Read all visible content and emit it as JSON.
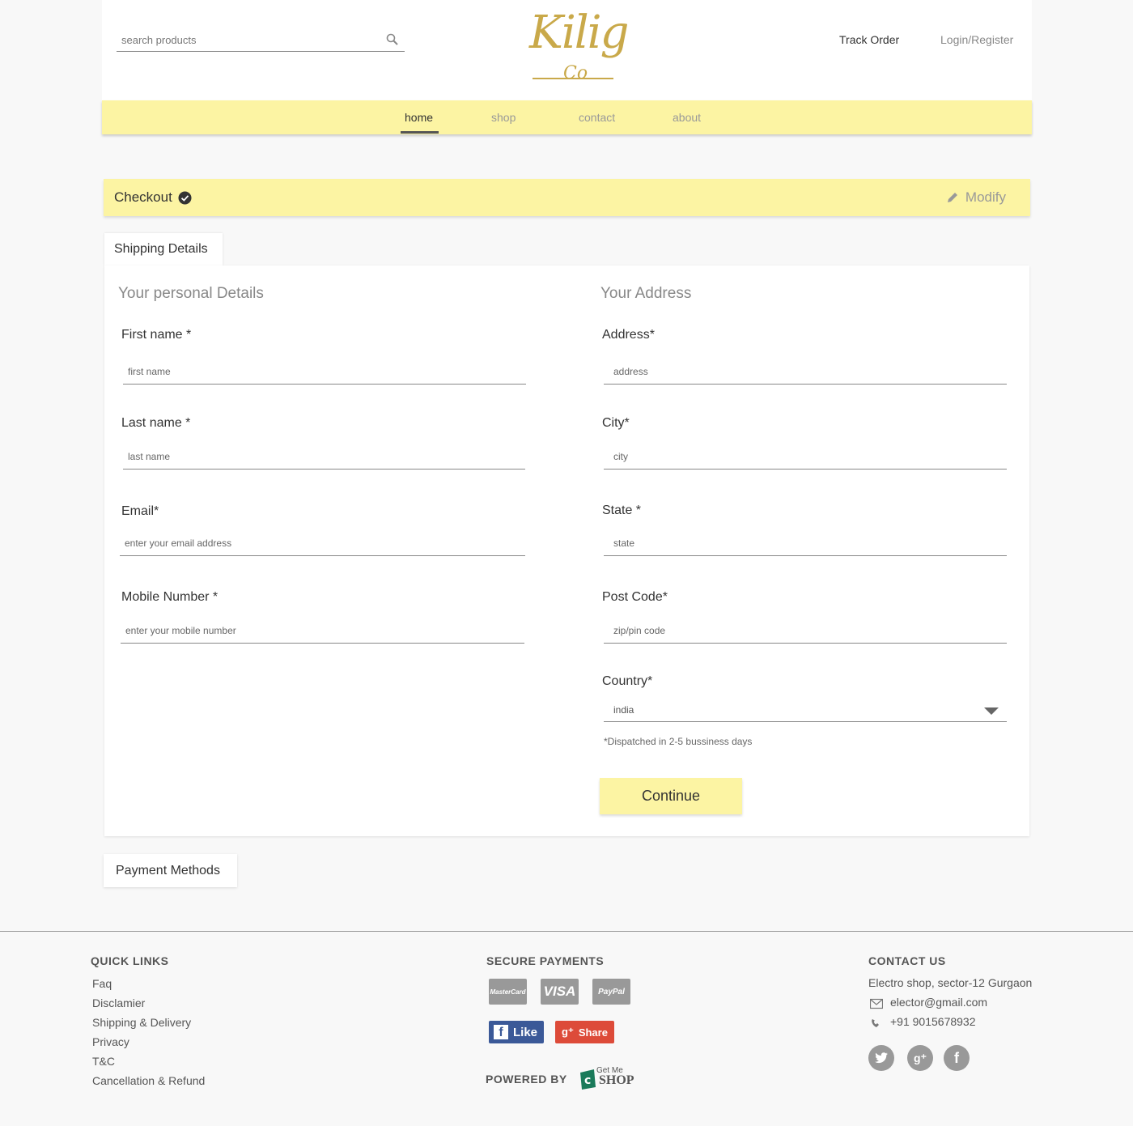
{
  "header": {
    "search_placeholder": "search products",
    "logo_text": "Kilig",
    "logo_sub": "Co",
    "track_order": "Track Order",
    "login": "Login/Register"
  },
  "nav": {
    "items": [
      {
        "label": "home",
        "active": true
      },
      {
        "label": "shop",
        "active": false
      },
      {
        "label": "contact",
        "active": false
      },
      {
        "label": "about",
        "active": false
      }
    ]
  },
  "checkout": {
    "title": "Checkout",
    "modify": "Modify"
  },
  "tabs": {
    "shipping": "Shipping Details",
    "payment": "Payment Methods"
  },
  "personal": {
    "title": "Your personal Details",
    "first_name": {
      "label": "First name *",
      "placeholder": "first name"
    },
    "last_name": {
      "label": "Last name *",
      "placeholder": "last name"
    },
    "email": {
      "label": "Email*",
      "placeholder": "enter your email address"
    },
    "mobile": {
      "label": "Mobile Number *",
      "placeholder": "enter your mobile number"
    }
  },
  "address": {
    "title": "Your Address",
    "address": {
      "label": "Address*",
      "placeholder": "address"
    },
    "city": {
      "label": "City*",
      "placeholder": "city"
    },
    "state": {
      "label": "State *",
      "placeholder": "state"
    },
    "postcode": {
      "label": "Post Code*",
      "placeholder": "zip/pin code"
    },
    "country": {
      "label": "Country*",
      "value": "india"
    },
    "note": "*Dispatched in 2-5 bussiness days",
    "continue": "Continue"
  },
  "footer": {
    "quick_links_title": "QUICK LINKS",
    "quick_links": [
      "Faq",
      "Disclamier",
      "Shipping & Delivery",
      "Privacy",
      "T&C",
      "Cancellation & Refund"
    ],
    "secure_title": "SECURE PAYMENTS",
    "cards": [
      "MasterCard",
      "VISA",
      "PayPal"
    ],
    "like": "Like",
    "share": "Share",
    "powered_by": "POWERED BY",
    "gms_top": "Get Me",
    "gms_bottom": "SHOP",
    "contact_title": "CONTACT US",
    "contact_address": "Electro shop, sector-12 Gurgaon",
    "contact_email": "elector@gmail.com",
    "contact_phone": "+91 9015678932"
  },
  "colors": {
    "accent": "#fcf4a3",
    "logo_gold": "#c9a94a",
    "facebook": "#3b5998",
    "gplus": "#dd4b39",
    "gms_green": "#1a7a5a"
  }
}
